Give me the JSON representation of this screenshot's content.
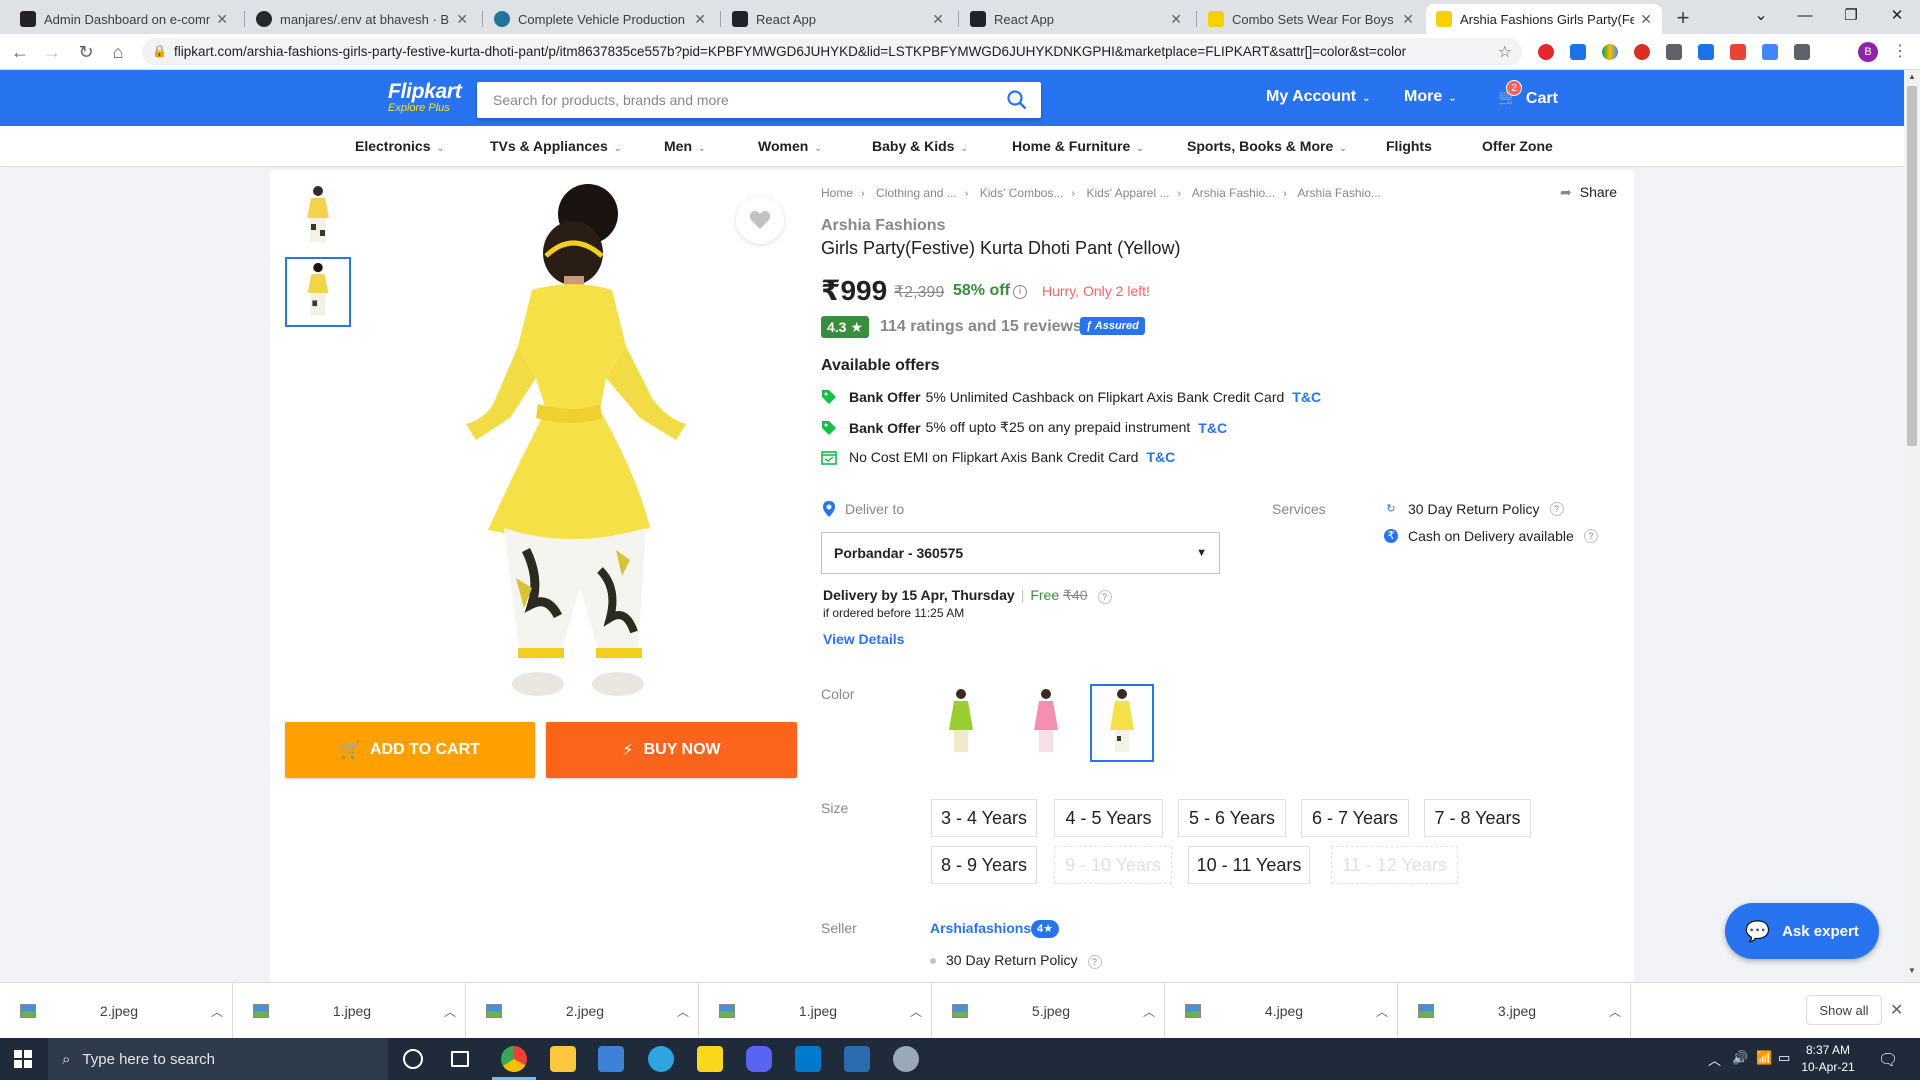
{
  "browser": {
    "tabs": [
      {
        "title": "Admin Dashboard on e-commerce",
        "color": "#222222"
      },
      {
        "title": "manjares/.env at bhavesh · Bhavesh",
        "color": "#24292e"
      },
      {
        "title": "Complete Vehicle Production in",
        "color": "#21759b"
      },
      {
        "title": "React App",
        "color": "#20232a"
      },
      {
        "title": "React App",
        "color": "#20232a"
      },
      {
        "title": "Combo Sets Wear For Boys - Buy",
        "color": "#f8d000"
      },
      {
        "title": "Arshia Fashions Girls Party(Festive",
        "color": "#f8d000"
      }
    ],
    "url": "flipkart.com/arshia-fashions-girls-party-festive-kurta-dhoti-pant/p/itm8637835ce557b?pid=KPBFYMWGD6JUHYKD&lid=LSTKPBFYMWGD6JUHYKDNKGPHI&marketplace=FLIPKART&sattr[]=color&st=color"
  },
  "header": {
    "logo": "Flipkart",
    "logo_sub": "Explore Plus",
    "search_placeholder": "Search for products, brands and more",
    "my_account": "My Account",
    "more": "More",
    "cart": "Cart",
    "cart_count": "2"
  },
  "categories": [
    "Electronics",
    "TVs & Appliances",
    "Men",
    "Women",
    "Baby & Kids",
    "Home & Furniture",
    "Sports, Books & More",
    "Flights",
    "Offer Zone"
  ],
  "product": {
    "breadcrumbs": [
      "Home",
      "Clothing and ...",
      "Kids' Combos...",
      "Kids' Apparel ...",
      "Arshia Fashio...",
      "Arshia Fashio..."
    ],
    "share": "Share",
    "brand": "Arshia Fashions",
    "title": "Girls Party(Festive) Kurta Dhoti Pant  (Yellow)",
    "price": "₹999",
    "mrp": "₹2,399",
    "discount": "58% off",
    "stock": "Hurry, Only 2 left!",
    "rating": "4.3 ★",
    "rating_text": "114 ratings and 15 reviews",
    "assured": "Assured",
    "add_to_cart": "ADD TO CART",
    "buy_now": "BUY NOW"
  },
  "offers": {
    "heading": "Available offers",
    "items": [
      {
        "bold": "Bank Offer",
        "text": "5% Unlimited Cashback on Flipkart Axis Bank Credit Card",
        "tc": "T&C"
      },
      {
        "bold": "Bank Offer",
        "text": "5% off upto ₹25 on any prepaid instrument",
        "tc": "T&C"
      },
      {
        "bold": "",
        "text": "No Cost EMI on Flipkart Axis Bank Credit Card",
        "tc": "T&C"
      }
    ]
  },
  "delivery": {
    "label": "Deliver to",
    "pincode": "Porbandar - 360575",
    "date": "Delivery by 15 Apr, Thursday",
    "free": "Free",
    "fee": "₹40",
    "ordered": "if ordered before 11:25 AM",
    "view_details": "View Details"
  },
  "services": {
    "label": "Services",
    "items": [
      "30 Day Return Policy",
      "Cash on Delivery available"
    ]
  },
  "color": {
    "label": "Color",
    "options": [
      {
        "name": "Green",
        "hex": "#9acd32"
      },
      {
        "name": "Pink",
        "hex": "#f48fb1"
      },
      {
        "name": "Yellow",
        "hex": "#f5e04a"
      }
    ],
    "selected_index": 2
  },
  "size": {
    "label": "Size",
    "row1": [
      "3 - 4 Years",
      "4 - 5 Years",
      "5 - 6 Years",
      "6 - 7 Years",
      "7 - 8 Years"
    ],
    "row2": [
      "8 - 9 Years",
      "9 - 10 Years",
      "10 - 11 Years",
      "11 - 12 Years"
    ],
    "row2_disabled": [
      false,
      true,
      false,
      true
    ]
  },
  "seller": {
    "label": "Seller",
    "name": "Arshiafashions",
    "rating": "4★",
    "policy": "30 Day Return Policy"
  },
  "ask_expert": "Ask expert",
  "downloads": {
    "files": [
      "2.jpeg",
      "1.jpeg",
      "2.jpeg",
      "1.jpeg",
      "5.jpeg",
      "4.jpeg",
      "3.jpeg"
    ],
    "show_all": "Show all"
  },
  "taskbar": {
    "search_placeholder": "Type here to search",
    "time": "8:37 AM",
    "date": "10-Apr-21"
  }
}
